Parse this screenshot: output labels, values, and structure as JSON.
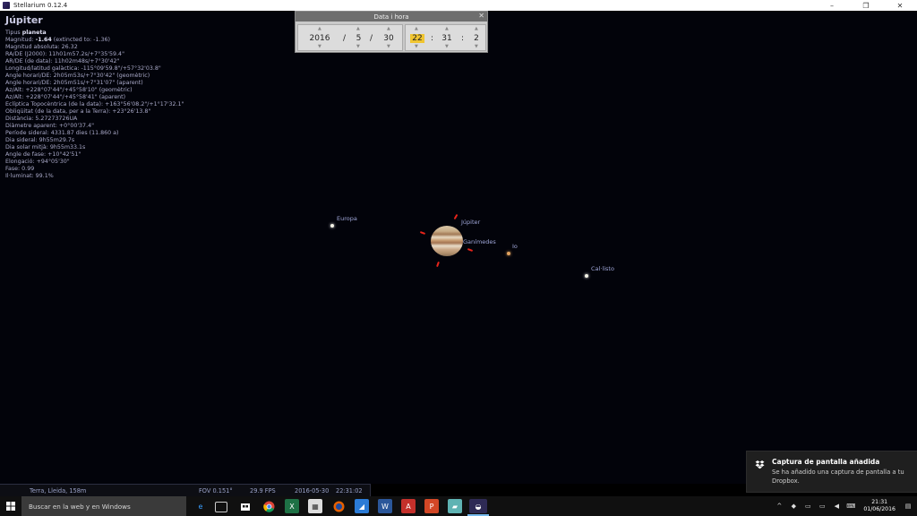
{
  "window": {
    "title": "Stellarium 0.12.4",
    "controls": {
      "minimize": "–",
      "maximize": "❐",
      "close": "✕"
    }
  },
  "info_panel": {
    "title": "Júpiter",
    "lines": [
      {
        "label": "Tipus ",
        "value": "planeta",
        "suffix": ""
      },
      {
        "label": "Magnitud: ",
        "value": "-1.64",
        "suffix": " (extincted to: -1.36)"
      },
      {
        "label": "Magnitud absoluta: 26.32",
        "value": "",
        "suffix": ""
      },
      {
        "label": "RA/DE (J2000): 11h01m57.2s/+7°35'59.4\"",
        "value": "",
        "suffix": ""
      },
      {
        "label": "AR/DE (de data): 11h02m48s/+7°30'42\"",
        "value": "",
        "suffix": ""
      },
      {
        "label": "Longitud/latitud galàctica: -115°09'59.8\"/+57°32'03.8\"",
        "value": "",
        "suffix": ""
      },
      {
        "label": "Angle horari/DE: 2h05m53s/+7°30'42\" (geomètric)",
        "value": "",
        "suffix": ""
      },
      {
        "label": "Angle horari/DE: 2h05m51s/+7°31'07\" (aparent)",
        "value": "",
        "suffix": ""
      },
      {
        "label": "Az/Alt: +228°07'44\"/+45°58'10\" (geomètric)",
        "value": "",
        "suffix": ""
      },
      {
        "label": "Az/Alt: +228°07'44\"/+45°58'41\" (aparent)",
        "value": "",
        "suffix": ""
      },
      {
        "label": "Eclíptica Topocèntrica (de la data): +163°56'08.2\"/+1°17'32.1\"",
        "value": "",
        "suffix": ""
      },
      {
        "label": "Obliqüitat (de la data, per a la Terra): +23°26'13.8\"",
        "value": "",
        "suffix": ""
      },
      {
        "label": "Distància: 5.27273726UA",
        "value": "",
        "suffix": ""
      },
      {
        "label": "Diàmetre aparent: +0°00'37.4\"",
        "value": "",
        "suffix": ""
      },
      {
        "label": "Període sideral: 4331.87 dies (11.860 a)",
        "value": "",
        "suffix": ""
      },
      {
        "label": "Dia sideral: 9h55m29.7s",
        "value": "",
        "suffix": ""
      },
      {
        "label": "Dia solar mitjà: 9h55m33.1s",
        "value": "",
        "suffix": ""
      },
      {
        "label": "Angle de fase: +10°42'51\"",
        "value": "",
        "suffix": ""
      },
      {
        "label": "Elongació: +94°05'30\"",
        "value": "",
        "suffix": ""
      },
      {
        "label": "Fase: 0.99",
        "value": "",
        "suffix": ""
      },
      {
        "label": "Il·luminat: 99.1%",
        "value": "",
        "suffix": ""
      }
    ]
  },
  "sky_labels": {
    "europa": "Europa",
    "jupiter": "Júpiter",
    "ganimedes": "Ganímedes",
    "io": "Io",
    "callisto": "Cal·listo"
  },
  "date_dialog": {
    "title": "Data i hora",
    "close": "✕",
    "year": "2016",
    "month": "5",
    "day": "30",
    "hour": "22",
    "minute": "31",
    "second": "2",
    "date_sep": "/",
    "time_sep": ":"
  },
  "status_bar": {
    "location": "Terra, Lleida, 158m",
    "fov": "FOV 0.151°",
    "fps": "29.9 FPS",
    "date": "2016-05-30",
    "time": "22:31:02"
  },
  "notification": {
    "title": "Captura de pantalla añadida",
    "message": "Se ha añadido una captura de pantalla a tu Dropbox."
  },
  "taskbar": {
    "search_placeholder": "Buscar en la web y en Windows",
    "clock_time": "21:31",
    "clock_date": "01/06/2016"
  },
  "colors": {
    "background": "#02030a",
    "info_text": "#a9a9c8",
    "marker": "#e8241a",
    "highlight": "#f0c530"
  }
}
